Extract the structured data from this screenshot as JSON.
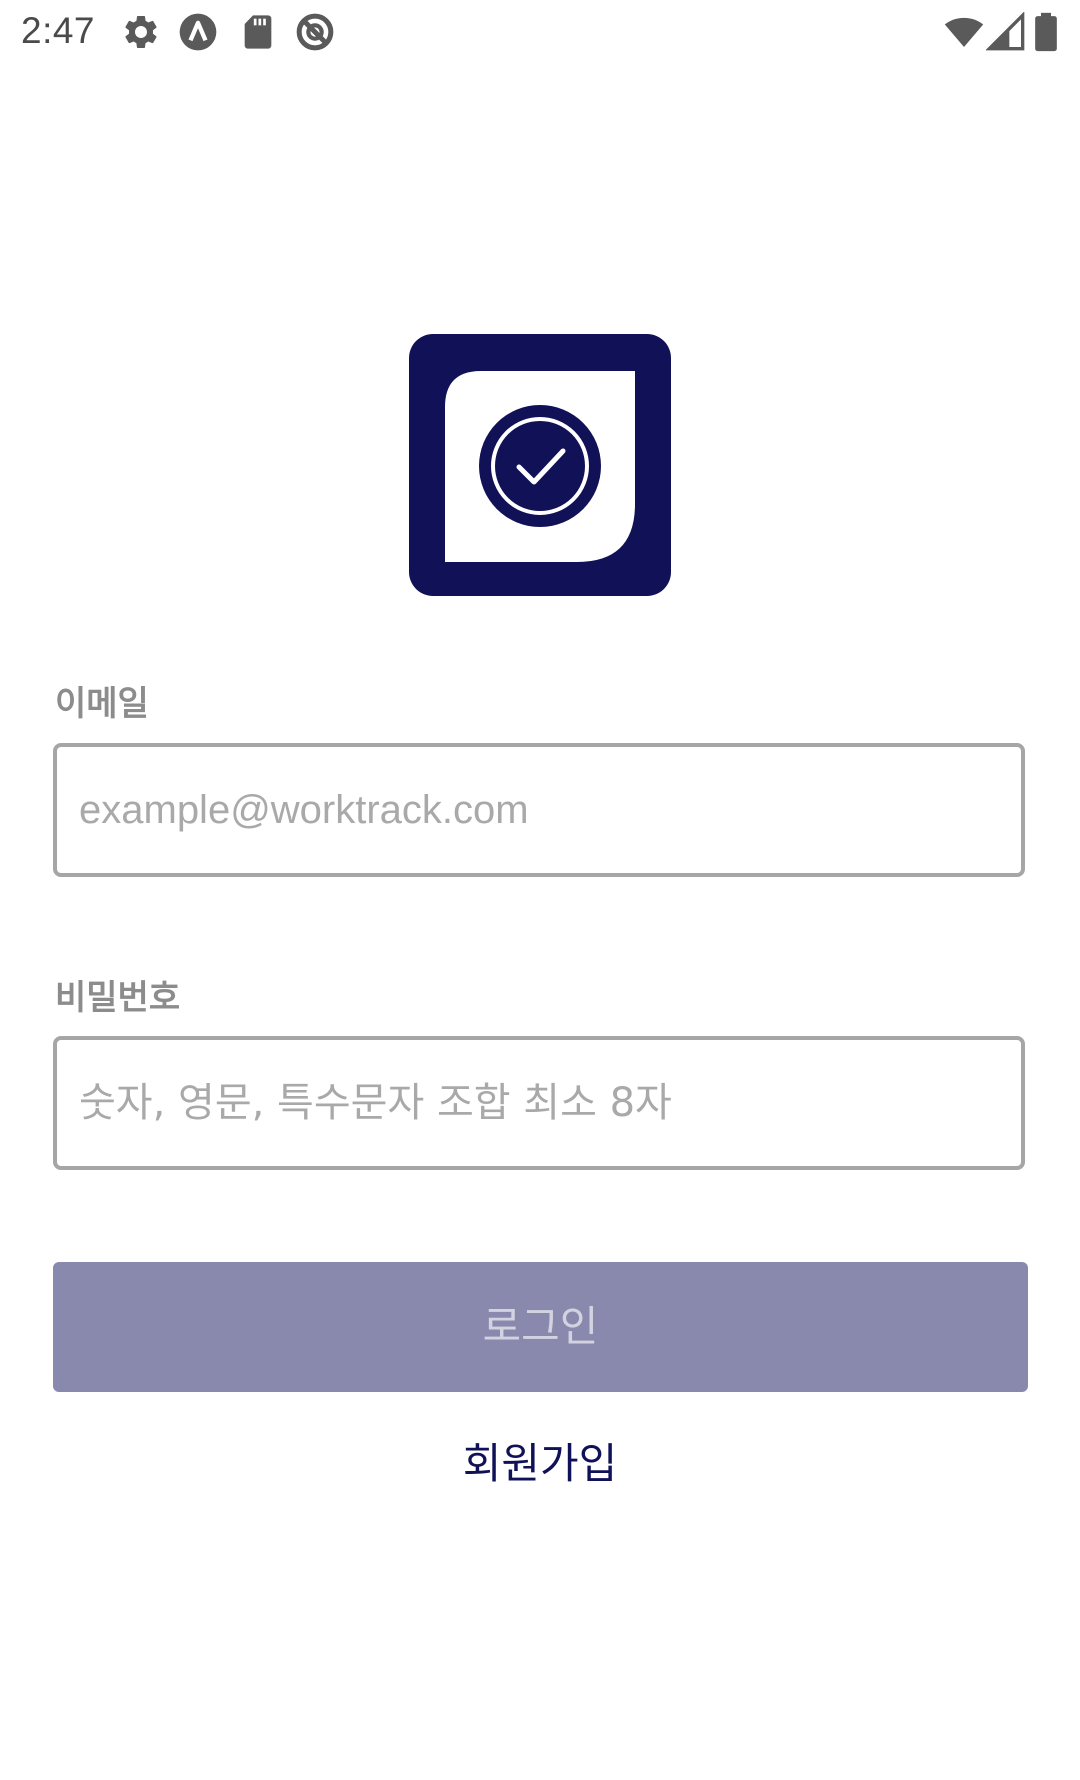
{
  "status_bar": {
    "time": "2:47",
    "left_icons": [
      "gear-icon",
      "app-a-icon",
      "sd-card-icon",
      "blocked-icon"
    ],
    "right_icons": [
      "wifi-icon",
      "cell-signal-icon",
      "battery-icon"
    ]
  },
  "logo": {
    "icon": "check-circle-logo",
    "background_color": "#111158",
    "foreground_color": "#ffffff"
  },
  "form": {
    "email": {
      "label": "이메일",
      "value": "",
      "placeholder": "example@worktrack.com"
    },
    "password": {
      "label": "비밀번호",
      "value": "",
      "placeholder": "숫자, 영문, 특수문자 조합 최소 8자"
    },
    "login_label": "로그인",
    "signup_label": "회원가입"
  },
  "colors": {
    "brand": "#111158",
    "login_button_disabled": "#8989ae",
    "label_gray": "#8c8c8c",
    "input_border": "#a6a6a6"
  }
}
